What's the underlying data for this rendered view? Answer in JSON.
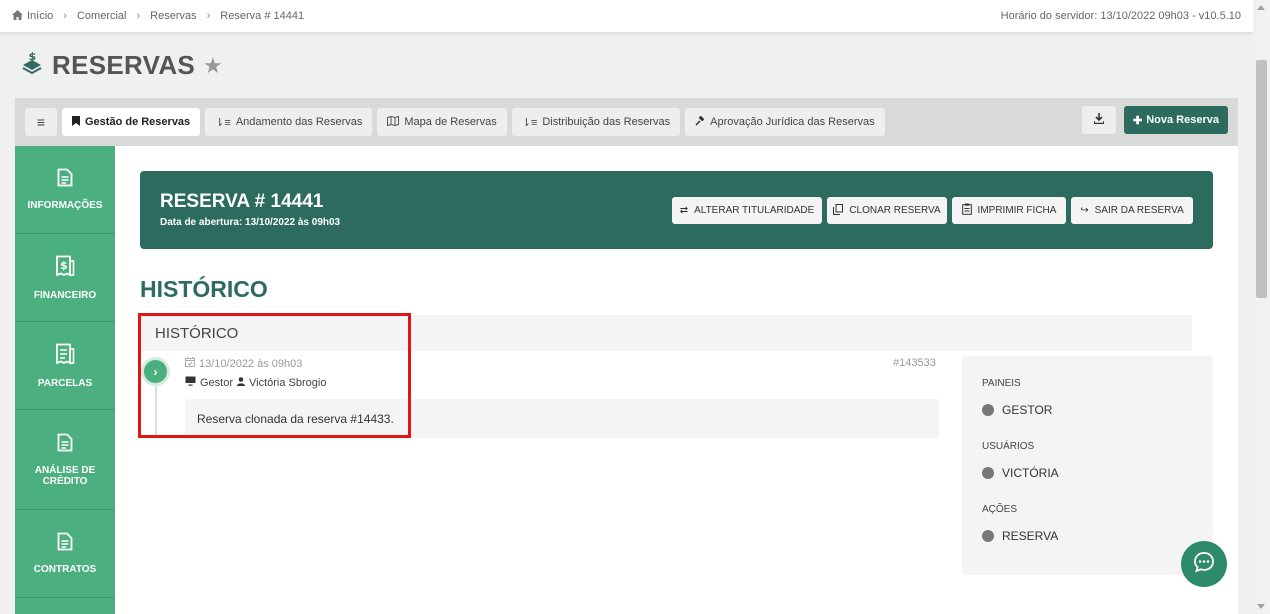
{
  "breadcrumb": {
    "items": [
      "Início",
      "Comercial",
      "Reservas",
      "Reserva # 14441"
    ],
    "server_time": "Horário do servidor: 13/10/2022 09h03 - v10.5.10"
  },
  "page": {
    "title": "RESERVAS"
  },
  "tabs": [
    {
      "label": "Gestão de Reservas",
      "icon": "bookmark-icon",
      "active": true
    },
    {
      "label": "Andamento das Reservas",
      "icon": "sort-icon",
      "active": false
    },
    {
      "label": "Mapa de Reservas",
      "icon": "map-icon",
      "active": false
    },
    {
      "label": "Distribuição das Reservas",
      "icon": "sort-icon",
      "active": false
    },
    {
      "label": "Aprovação Jurídica das Reservas",
      "icon": "gavel-icon",
      "active": false
    }
  ],
  "toolbar": {
    "new_label": "Nova Reserva"
  },
  "sidebar": {
    "items": [
      {
        "label": "INFORMAÇÕES",
        "icon": "document-icon"
      },
      {
        "label": "FINANCEIRO",
        "icon": "money-receipt-icon"
      },
      {
        "label": "PARCELAS",
        "icon": "receipt-list-icon"
      },
      {
        "label": "ANÁLISE DE CRÉDITO",
        "icon": "document-icon"
      },
      {
        "label": "CONTRATOS",
        "icon": "document-icon"
      }
    ]
  },
  "reserva": {
    "title": "RESERVA # 14441",
    "opened": "Data de abertura: 13/10/2022 às 09h03",
    "buttons": {
      "alterar": "ALTERAR TITULARIDADE",
      "clonar": "CLONAR RESERVA",
      "imprimir": "IMPRIMIR FICHA",
      "sair": "SAIR DA RESERVA"
    }
  },
  "historico": {
    "section_title": "HISTÓRICO",
    "panel_title": "HISTÓRICO",
    "entry": {
      "date": "13/10/2022 às 09h03",
      "panel": "Gestor",
      "user": "Victória Sbrogio",
      "id": "#143533",
      "message": "Reserva clonada da reserva #14433."
    }
  },
  "filters": {
    "paineis_label": "PAINEIS",
    "paineis_value": "GESTOR",
    "usuarios_label": "USUÁRIOS",
    "usuarios_value": "VICTÓRIA",
    "acoes_label": "AÇÕES",
    "acoes_value": "RESERVA"
  },
  "colors": {
    "primary": "#2d6b5f",
    "sidebar": "#4caf7f",
    "highlight": "#e31414"
  }
}
